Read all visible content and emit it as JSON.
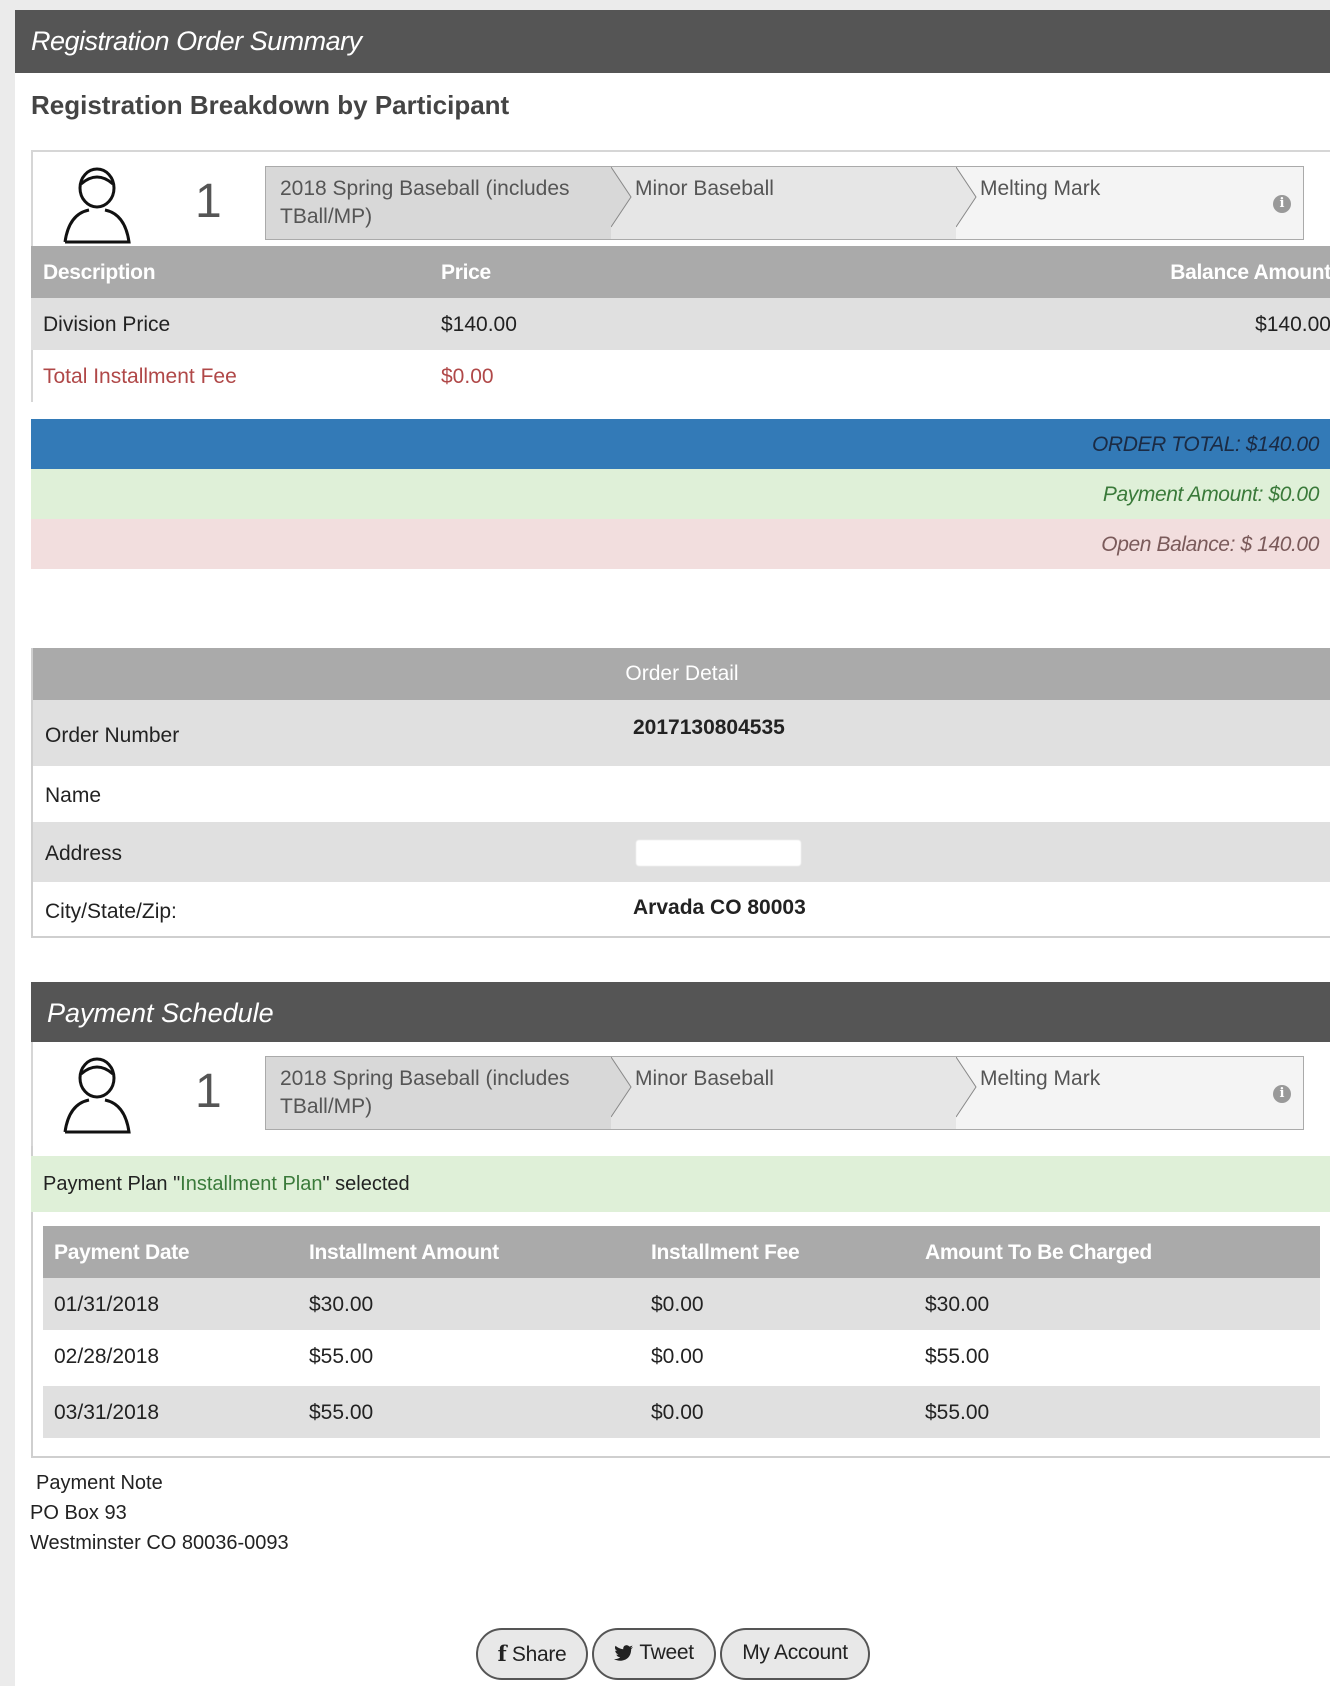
{
  "header": {
    "title": "Registration Order Summary"
  },
  "breakdown": {
    "heading": "Registration Breakdown by Participant",
    "participant": {
      "number": "1",
      "crumbs": [
        "2018 Spring Baseball (includes TBall/MP)",
        "Minor Baseball",
        "Melting Mark"
      ],
      "info_icon": "info-icon"
    },
    "columns": [
      "Description",
      "Price",
      "Balance Amount"
    ],
    "rows": [
      {
        "description": "Division Price",
        "price": "$140.00",
        "balance": "$140.00"
      },
      {
        "description": "Total Installment Fee",
        "price": "$0.00",
        "balance": ""
      }
    ]
  },
  "totals": {
    "order_total": "ORDER TOTAL: $140.00",
    "payment_amount": "Payment Amount: $0.00",
    "open_balance": "Open Balance: $ 140.00",
    "colors": {
      "order_total_bg": "#337ab7",
      "payment_bg": "#dff0d8",
      "balance_bg": "#f2dede"
    }
  },
  "order_detail": {
    "heading": "Order Detail",
    "order_number_label": "Order Number",
    "order_number": "2017130804535",
    "name_label": "Name",
    "name": "",
    "address_label": "Address",
    "city_label": "City/State/Zip:",
    "city": "Arvada CO 80003"
  },
  "schedule": {
    "title": "Payment Schedule",
    "participant": {
      "number": "1",
      "crumbs": [
        "2018 Spring Baseball (includes TBall/MP)",
        "Minor Baseball",
        "Melting Mark"
      ]
    },
    "plan_prefix": "Payment Plan \"",
    "plan_name": "Installment Plan",
    "plan_suffix": "\" selected",
    "columns": [
      "Payment Date",
      "Installment Amount",
      "Installment Fee",
      "Amount To Be Charged"
    ],
    "rows": [
      {
        "date": "01/31/2018",
        "amount": "$30.00",
        "fee": "$0.00",
        "charged": "$30.00"
      },
      {
        "date": "02/28/2018",
        "amount": "$55.00",
        "fee": "$0.00",
        "charged": "$55.00"
      },
      {
        "date": "03/31/2018",
        "amount": "$55.00",
        "fee": "$0.00",
        "charged": "$55.00"
      }
    ]
  },
  "note": {
    "label": "Payment Note",
    "line1": "PO Box 93",
    "line2": "Westminster CO 80036-0093"
  },
  "buttons": {
    "share": "Share",
    "tweet": "Tweet",
    "account": "My Account"
  }
}
